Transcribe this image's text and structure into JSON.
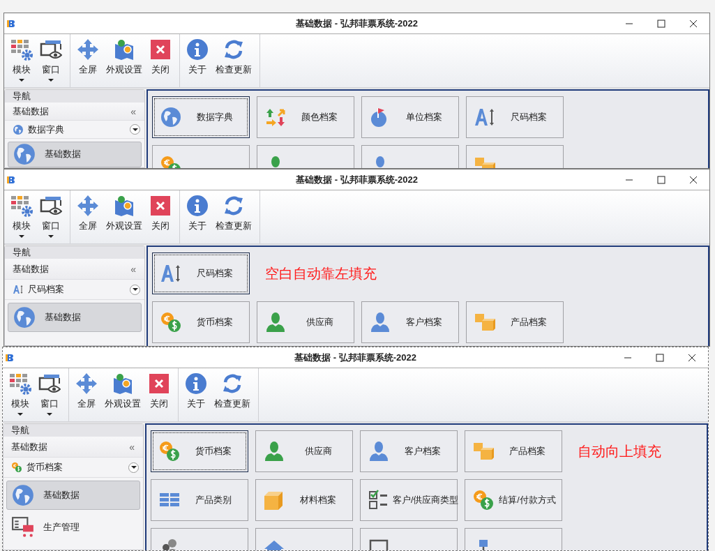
{
  "windows": [
    {
      "title": "基础数据 - 弘邦菲票系统-2022",
      "ribbon": [
        {
          "buttons": [
            {
              "label": "模块",
              "kind": "modules",
              "dropdown": true
            },
            {
              "label": "窗口",
              "kind": "window",
              "dropdown": true
            }
          ]
        },
        {
          "buttons": [
            {
              "label": "全屏",
              "kind": "fullscreen",
              "dropdown": false
            },
            {
              "label": "外观设置",
              "kind": "skin",
              "dropdown": false
            },
            {
              "label": "关闭",
              "kind": "close",
              "dropdown": false
            }
          ]
        },
        {
          "buttons": [
            {
              "label": "关于",
              "kind": "info",
              "dropdown": false
            },
            {
              "label": "检查更新",
              "kind": "refresh",
              "dropdown": false
            }
          ]
        }
      ],
      "nav": {
        "header": "导航",
        "group": "基础数据",
        "collapse": "«",
        "current": {
          "label": "数据字典",
          "kind": "globe"
        },
        "items": [
          {
            "label": "基础数据",
            "kind": "globe",
            "selected": true
          }
        ]
      },
      "rows": [
        [
          {
            "kind": "globe",
            "label": "数据字典",
            "selected": true
          },
          {
            "kind": "arrows",
            "label": "颜色档案",
            "selected": false
          },
          {
            "kind": "flag",
            "label": "单位档案",
            "selected": false
          },
          {
            "kind": "size",
            "label": "尺码档案",
            "selected": false
          }
        ],
        [
          {
            "kind": "coins",
            "selected": false
          },
          {
            "kind": "person-green",
            "selected": false
          },
          {
            "kind": "person-blue",
            "selected": false
          },
          {
            "kind": "boxes",
            "selected": false
          }
        ]
      ]
    },
    {
      "title": "基础数据 - 弘邦菲票系统-2022",
      "ribbon": [
        {
          "buttons": [
            {
              "label": "模块",
              "kind": "modules",
              "dropdown": true
            },
            {
              "label": "窗口",
              "kind": "window",
              "dropdown": true
            }
          ]
        },
        {
          "buttons": [
            {
              "label": "全屏",
              "kind": "fullscreen",
              "dropdown": false
            },
            {
              "label": "外观设置",
              "kind": "skin",
              "dropdown": false
            },
            {
              "label": "关闭",
              "kind": "close",
              "dropdown": false
            }
          ]
        },
        {
          "buttons": [
            {
              "label": "关于",
              "kind": "info",
              "dropdown": false
            },
            {
              "label": "检查更新",
              "kind": "refresh",
              "dropdown": false
            }
          ]
        }
      ],
      "nav": {
        "header": "导航",
        "group": "基础数据",
        "collapse": "«",
        "current": {
          "label": "尺码档案",
          "kind": "size"
        },
        "items": [
          {
            "label": "基础数据",
            "kind": "globe",
            "selected": true
          }
        ]
      },
      "rows": [
        [
          {
            "kind": "size",
            "label": "尺码档案",
            "selected": true
          },
          {
            "kind": "note",
            "label": "空白自动靠左填充"
          }
        ],
        [
          {
            "kind": "coins",
            "label": "货币档案",
            "selected": false
          },
          {
            "kind": "person-green",
            "label": "供应商",
            "selected": false
          },
          {
            "kind": "person-blue",
            "label": "客户档案",
            "selected": false
          },
          {
            "kind": "boxes",
            "label": "产品档案",
            "selected": false
          }
        ]
      ]
    },
    {
      "title": "基础数据 - 弘邦菲票系统-2022",
      "ribbon": [
        {
          "buttons": [
            {
              "label": "模块",
              "kind": "modules",
              "dropdown": true
            },
            {
              "label": "窗口",
              "kind": "window",
              "dropdown": true
            }
          ]
        },
        {
          "buttons": [
            {
              "label": "全屏",
              "kind": "fullscreen",
              "dropdown": false
            },
            {
              "label": "外观设置",
              "kind": "skin",
              "dropdown": false
            },
            {
              "label": "关闭",
              "kind": "close",
              "dropdown": false
            }
          ]
        },
        {
          "buttons": [
            {
              "label": "关于",
              "kind": "info",
              "dropdown": false
            },
            {
              "label": "检查更新",
              "kind": "refresh",
              "dropdown": false
            }
          ]
        }
      ],
      "nav": {
        "header": "导航",
        "group": "基础数据",
        "collapse": "«",
        "current": {
          "label": "货币档案",
          "kind": "coins"
        },
        "items": [
          {
            "label": "基础数据",
            "kind": "globe",
            "selected": true
          },
          {
            "label": "生产管理",
            "kind": "production",
            "selected": false
          }
        ]
      },
      "rows": [
        [
          {
            "kind": "coins",
            "label": "货币档案",
            "selected": true
          },
          {
            "kind": "person-green",
            "label": "供应商",
            "selected": false
          },
          {
            "kind": "person-blue",
            "label": "客户档案",
            "selected": false
          },
          {
            "kind": "boxes",
            "label": "产品档案",
            "selected": false
          },
          {
            "kind": "note",
            "label": "自动向上填充"
          }
        ],
        [
          {
            "kind": "table",
            "label": "产品类别",
            "selected": false
          },
          {
            "kind": "box",
            "label": "材料档案",
            "selected": false
          },
          {
            "kind": "checklist",
            "label": "客户/供应商类型",
            "selected": false
          },
          {
            "kind": "coins",
            "label": "结算/付款方式",
            "selected": false
          }
        ],
        [
          {
            "kind": "people",
            "selected": false
          },
          {
            "kind": "warehouse",
            "selected": false
          },
          {
            "kind": "square",
            "selected": false
          },
          {
            "kind": "network",
            "selected": false
          }
        ]
      ]
    }
  ]
}
